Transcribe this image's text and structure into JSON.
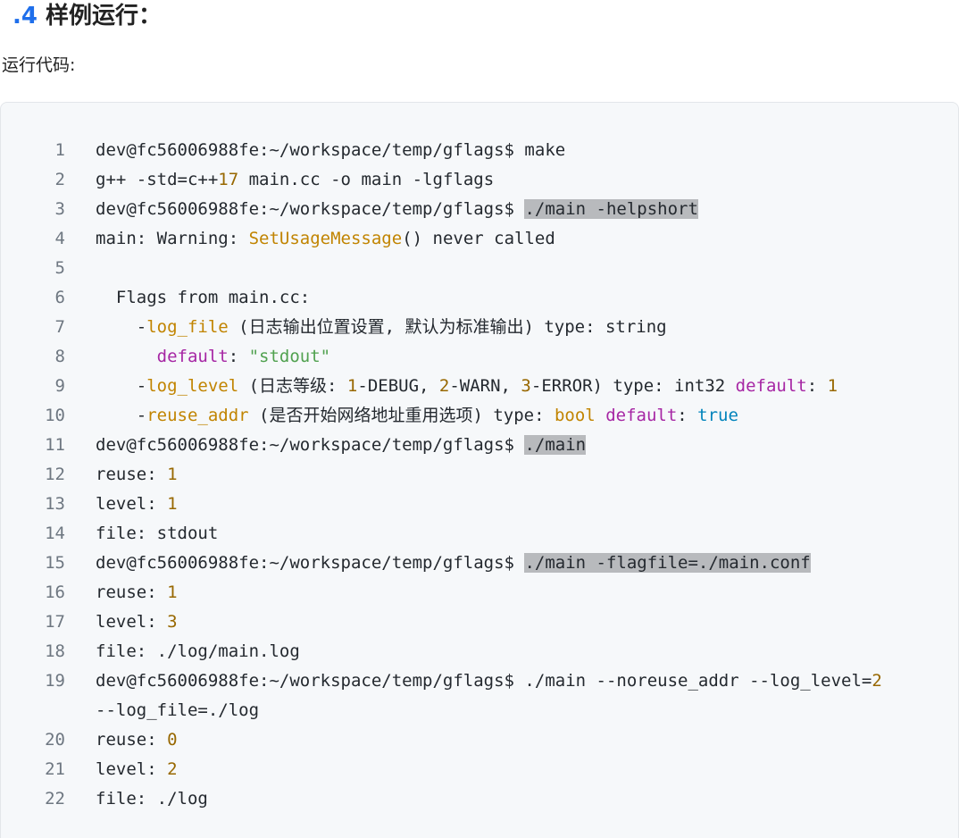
{
  "heading": {
    "number": "⁠.4",
    "title": " 样例运行："
  },
  "intro": "运行代码:",
  "code": {
    "lines": [
      {
        "n": "1",
        "parts": [
          [
            "dev@fc56006988fe:~/workspace/temp/gflags$ make",
            ""
          ]
        ]
      },
      {
        "n": "2",
        "parts": [
          [
            "g++ -std=c++",
            ""
          ],
          [
            "17",
            "num"
          ],
          [
            " main.cc -o main -lgflags",
            ""
          ]
        ]
      },
      {
        "n": "3",
        "parts": [
          [
            "dev@fc56006988fe:~/workspace/temp/gflags$ ",
            ""
          ],
          [
            "./main -helpshort",
            "hl"
          ]
        ]
      },
      {
        "n": "4",
        "parts": [
          [
            "main: Warning: ",
            ""
          ],
          [
            "SetUsageMessage",
            "fn"
          ],
          [
            "() never called",
            ""
          ]
        ]
      },
      {
        "n": "5",
        "parts": [
          [
            "",
            ""
          ]
        ]
      },
      {
        "n": "6",
        "parts": [
          [
            "  Flags from main.cc:",
            ""
          ]
        ]
      },
      {
        "n": "7",
        "parts": [
          [
            "    -",
            ""
          ],
          [
            "log_file",
            "var"
          ],
          [
            " (日志输出位置设置, 默认为标准输出) type: string",
            ""
          ]
        ]
      },
      {
        "n": "8",
        "parts": [
          [
            "      ",
            ""
          ],
          [
            "default",
            "kw"
          ],
          [
            ": ",
            ""
          ],
          [
            "\"stdout\"",
            "str"
          ]
        ]
      },
      {
        "n": "9",
        "parts": [
          [
            "    -",
            ""
          ],
          [
            "log_level",
            "var"
          ],
          [
            " (日志等级: ",
            ""
          ],
          [
            "1",
            "num"
          ],
          [
            "-DEBUG, ",
            ""
          ],
          [
            "2",
            "num"
          ],
          [
            "-WARN, ",
            ""
          ],
          [
            "3",
            "num"
          ],
          [
            "-ERROR) type: int32 ",
            ""
          ],
          [
            "default",
            "kw"
          ],
          [
            ": ",
            ""
          ],
          [
            "1",
            "num"
          ]
        ]
      },
      {
        "n": "10",
        "parts": [
          [
            "    -",
            ""
          ],
          [
            "reuse_addr",
            "var"
          ],
          [
            " (是否开始网络地址重用选项) type: ",
            ""
          ],
          [
            "bool",
            "fn"
          ],
          [
            " ",
            ""
          ],
          [
            "default",
            "kw"
          ],
          [
            ": ",
            ""
          ],
          [
            "true",
            "lit"
          ]
        ]
      },
      {
        "n": "11",
        "parts": [
          [
            "dev@fc56006988fe:~/workspace/temp/gflags$ ",
            ""
          ],
          [
            "./main",
            "hl"
          ]
        ]
      },
      {
        "n": "12",
        "parts": [
          [
            "reuse: ",
            ""
          ],
          [
            "1",
            "num"
          ]
        ]
      },
      {
        "n": "13",
        "parts": [
          [
            "level: ",
            ""
          ],
          [
            "1",
            "num"
          ]
        ]
      },
      {
        "n": "14",
        "parts": [
          [
            "file: stdout",
            ""
          ]
        ]
      },
      {
        "n": "15",
        "parts": [
          [
            "dev@fc56006988fe:~/workspace/temp/gflags$ ",
            ""
          ],
          [
            "./main -flagfile=./main.conf",
            "hl"
          ]
        ]
      },
      {
        "n": "16",
        "parts": [
          [
            "reuse: ",
            ""
          ],
          [
            "1",
            "num"
          ]
        ]
      },
      {
        "n": "17",
        "parts": [
          [
            "level: ",
            ""
          ],
          [
            "3",
            "num"
          ]
        ]
      },
      {
        "n": "18",
        "parts": [
          [
            "file: ./log/main.log",
            ""
          ]
        ]
      },
      {
        "n": "19",
        "parts": [
          [
            "dev@fc56006988fe:~/workspace/temp/gflags$ ./main --noreuse_addr --log_level=",
            ""
          ],
          [
            "2",
            "num"
          ]
        ],
        "cont": [
          [
            "--log_file=./log",
            ""
          ]
        ]
      },
      {
        "n": "20",
        "parts": [
          [
            "reuse: ",
            ""
          ],
          [
            "0",
            "num"
          ]
        ]
      },
      {
        "n": "21",
        "parts": [
          [
            "level: ",
            ""
          ],
          [
            "2",
            "num"
          ]
        ]
      },
      {
        "n": "22",
        "parts": [
          [
            "file: ./log",
            ""
          ]
        ]
      }
    ]
  }
}
